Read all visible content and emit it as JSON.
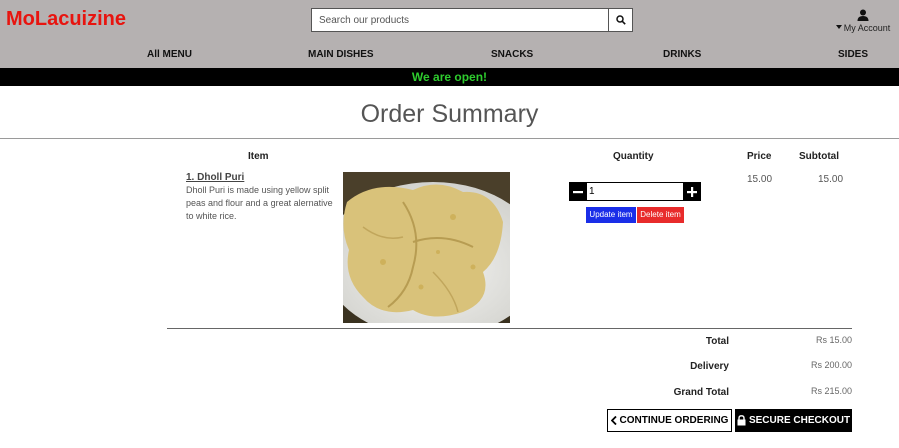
{
  "header": {
    "brand": "MoLacuizine",
    "search_placeholder": "Search our products",
    "account_label": "My Account"
  },
  "nav": {
    "items": [
      "All MENU",
      "MAIN DISHES",
      "SNACKS",
      "DRINKS",
      "SIDES"
    ]
  },
  "status": "We are open!",
  "page": {
    "title": "Order Summary"
  },
  "table": {
    "headers": {
      "item": "Item",
      "quantity": "Quantity",
      "price": "Price",
      "subtotal": "Subtotal"
    },
    "rows": [
      {
        "name": "1. Dholl Puri",
        "description": "Dholl Puri is made using yellow split peas and flour and a great alernative to white rice.",
        "quantity": "1",
        "price": "15.00",
        "subtotal": "15.00",
        "update_label": "Update item",
        "delete_label": "Delete item"
      }
    ]
  },
  "summary": {
    "total_label": "Total",
    "total_value": "Rs 15.00",
    "delivery_label": "Delivery",
    "delivery_value": "Rs 200.00",
    "grand_total_label": "Grand Total",
    "grand_total_value": "Rs 215.00"
  },
  "actions": {
    "continue_label": "CONTINUE ORDERING",
    "checkout_label": "SECURE CHECKOUT"
  },
  "colors": {
    "brand": "#e8140f",
    "header_bg": "#b5b1b1",
    "status_text": "#2ecc2e",
    "update_button": "#1a2ee8",
    "delete_button": "#e82b2b"
  },
  "icons": {
    "search": "search-icon",
    "user": "user-icon",
    "caret": "caret-down-icon",
    "minus": "minus-icon",
    "plus": "plus-icon",
    "chevron_left": "chevron-left-icon",
    "lock": "lock-icon"
  }
}
